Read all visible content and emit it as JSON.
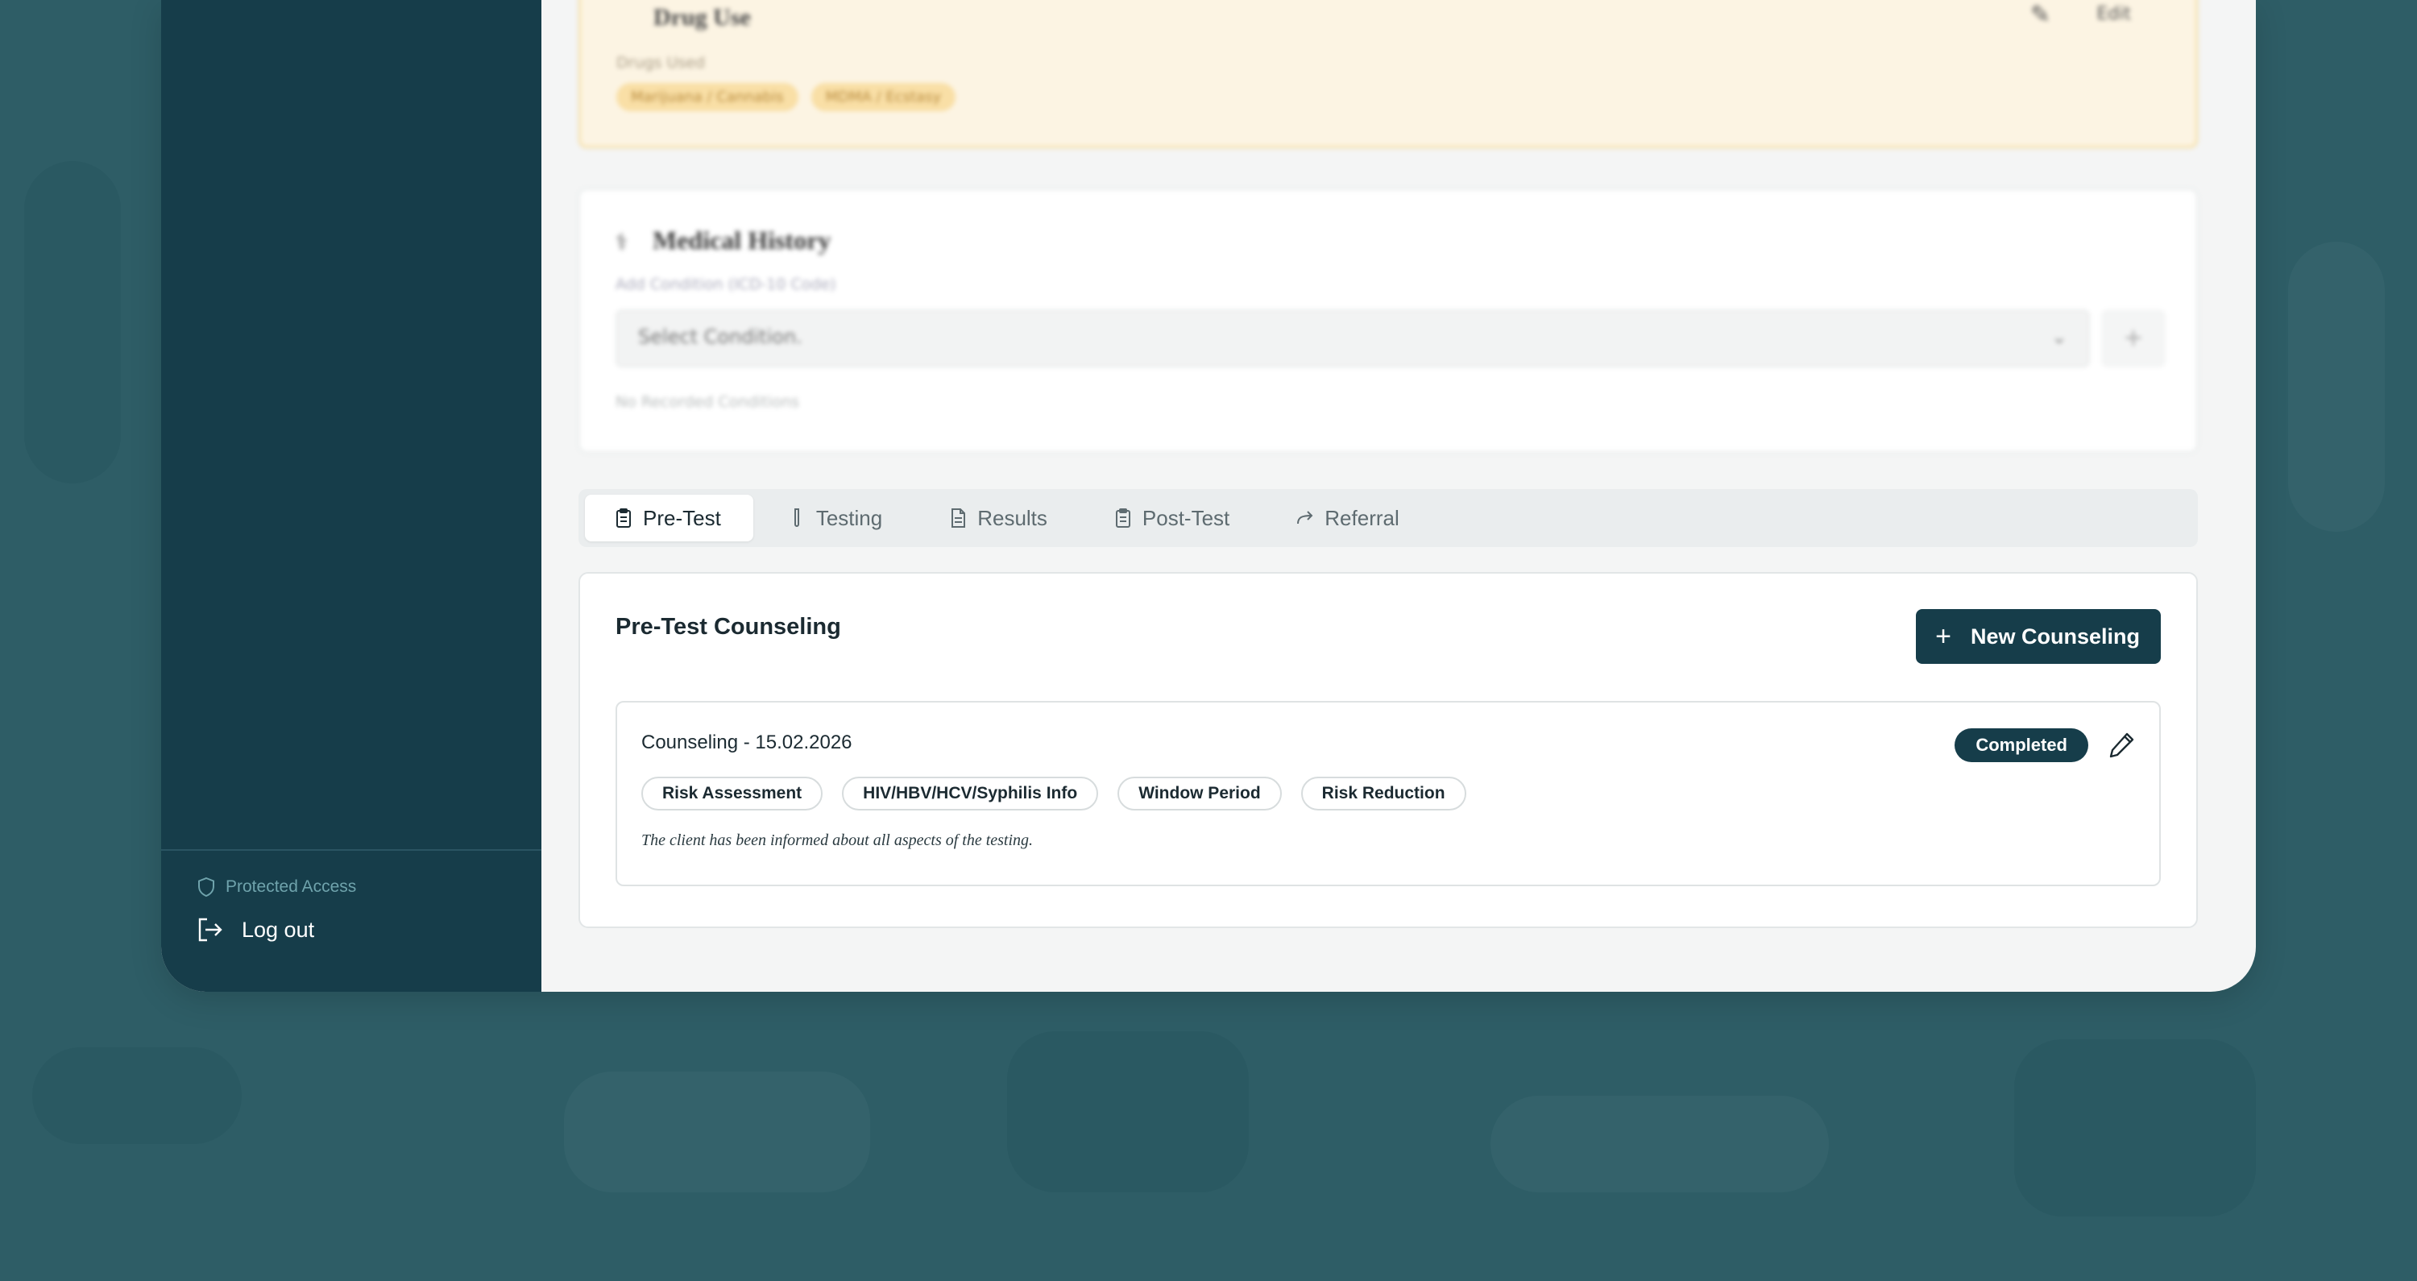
{
  "drug_use": {
    "title": "Drug Use",
    "field_label": "Drugs Used",
    "tags": [
      "Marijuana / Cannabis",
      "MDMA / Ecstasy"
    ],
    "edit_label": "Edit"
  },
  "medical_history": {
    "title": "Medical History",
    "add_label": "Add Condition (ICD-10 Code)",
    "select_placeholder": "Select Condition.",
    "add_button": "+",
    "empty_text": "No Recorded Conditions"
  },
  "tabs": [
    {
      "label": "Pre-Test",
      "icon": "clipboard-icon",
      "active": true
    },
    {
      "label": "Testing",
      "icon": "test-tube-icon",
      "active": false
    },
    {
      "label": "Results",
      "icon": "document-icon",
      "active": false
    },
    {
      "label": "Post-Test",
      "icon": "clipboard-icon",
      "active": false
    },
    {
      "label": "Referral",
      "icon": "arrow-forward-icon",
      "active": false
    }
  ],
  "panel": {
    "title": "Pre-Test Counseling",
    "new_button": "New Counseling",
    "records": [
      {
        "title": "Counseling - 15.02.2026",
        "status": "Completed",
        "tags": [
          "Risk Assessment",
          "HIV/HBV/HCV/Syphilis Info",
          "Window Period",
          "Risk Reduction"
        ],
        "note": "The client has been informed about all aspects of the testing."
      }
    ]
  },
  "sidebar": {
    "protected_label": "Protected Access",
    "logout_label": "Log out"
  },
  "colors": {
    "primary": "#163d4a",
    "background": "#2e5d66",
    "drug_card_bg": "#fcf4e3",
    "tag_yellow": "#f9dfa6"
  }
}
